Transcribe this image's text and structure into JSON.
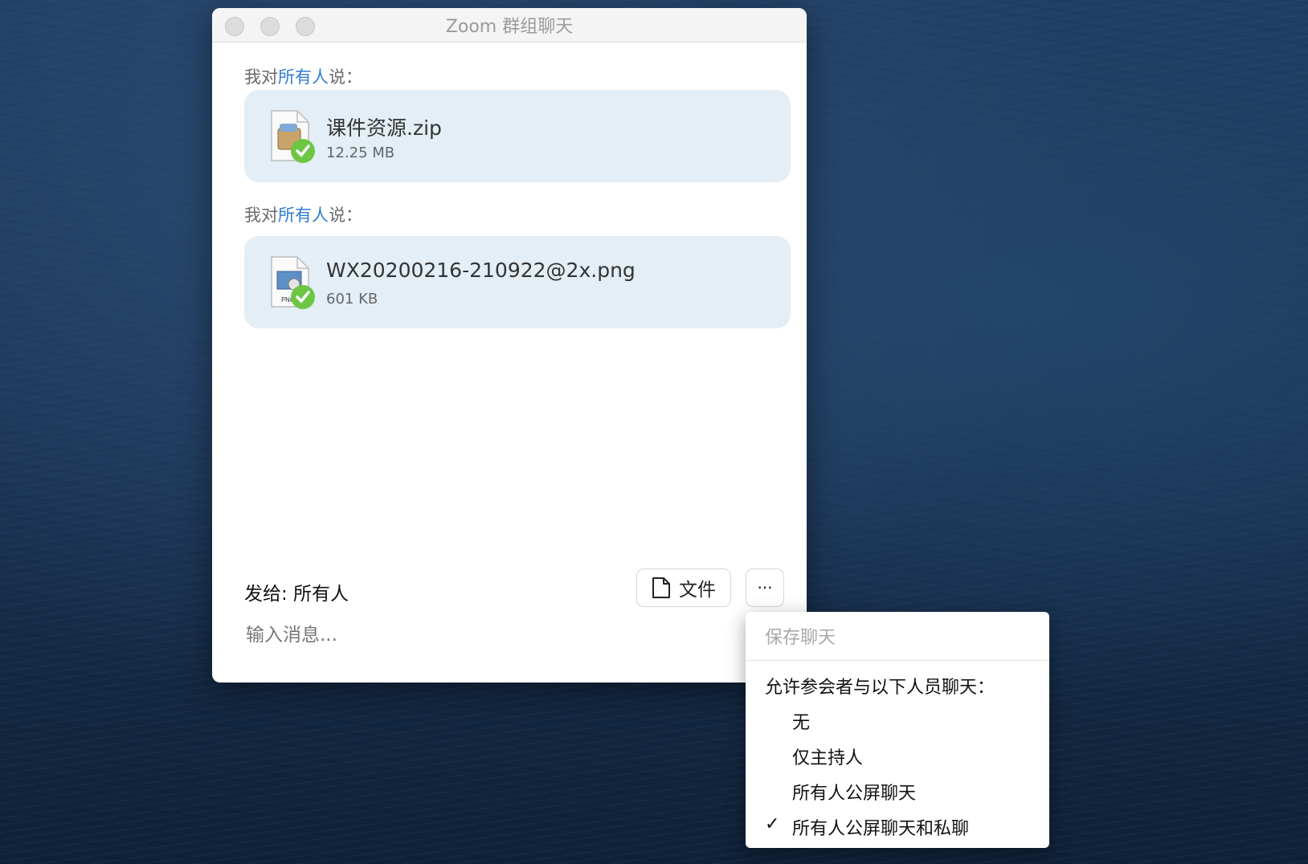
{
  "window": {
    "title": "Zoom 群组聊天"
  },
  "messages": [
    {
      "prefix": "我对",
      "target": "所有人",
      "suffix": "说：",
      "file_name": "课件资源.zip",
      "file_size": "12.25 MB",
      "file_type": "zip-archive-icon"
    },
    {
      "prefix": "我对",
      "target": "所有人",
      "suffix": "说：",
      "file_name": "WX20200216-210922@2x.png",
      "file_size": "601 KB",
      "file_type": "png-image-icon"
    }
  ],
  "composer": {
    "send_to": "发给: 所有人",
    "file_button": "文件",
    "more_button": "···",
    "placeholder": "输入消息..."
  },
  "menu": {
    "save_chat": "保存聊天",
    "section_label": "允许参会者与以下人员聊天：",
    "options": [
      "无",
      "仅主持人",
      "所有人公屏聊天",
      "所有人公屏聊天和私聊"
    ],
    "selected": "所有人公屏聊天和私聊",
    "check_mark": "✓"
  },
  "colors": {
    "accent": "#2f7bd6",
    "bubble": "#e3eef6",
    "success": "#6cc644"
  }
}
